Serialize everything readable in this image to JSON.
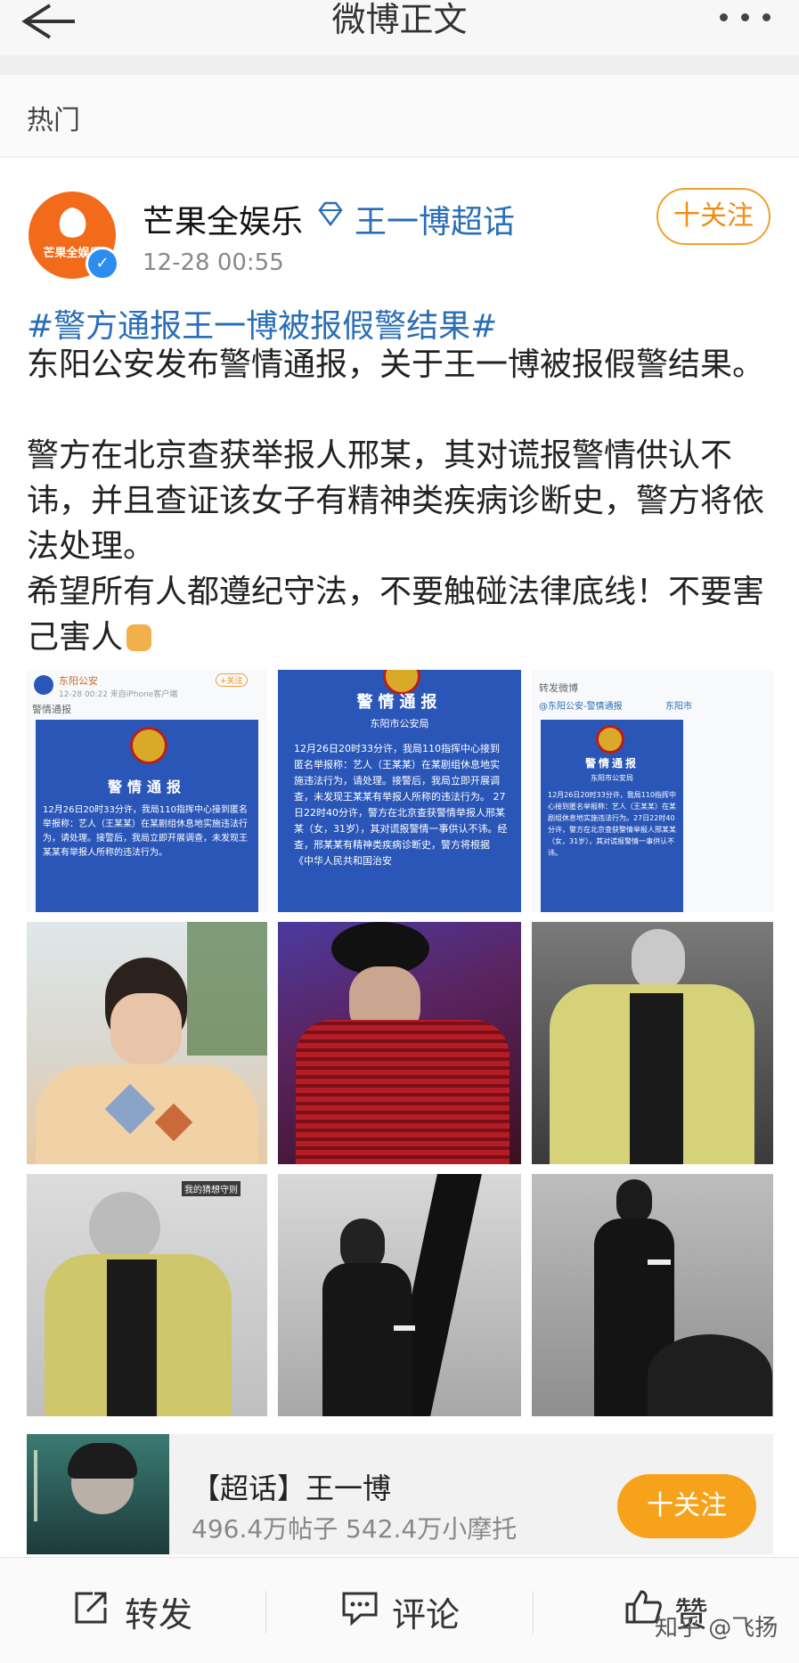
{
  "nav": {
    "title": "微博正文"
  },
  "section_label": "热门",
  "post": {
    "author": "芒果全娱乐",
    "avatar_text": "芒果全娱乐",
    "topic": "王一博超话",
    "time": "12-28 00:55",
    "follow_label": "十关注",
    "hashtag": "#警方通报王一博被报假警结果#",
    "paragraphs": [
      "东阳公安发布警情通报，关于王一博被报假警结果。",
      "警方在北京查获举报人邢某，其对谎报警情供认不讳，并且查证该女子有精神类疾病诊断史，警方将依法处理。",
      "希望所有人都遵纪守法，不要触碰法律底线！不要害己害人"
    ]
  },
  "images": {
    "notice1": {
      "account": "东阳公安",
      "meta": "12-28 00:22 来自iPhone客户端",
      "follow": "+关注",
      "section": "警情通报",
      "title": "警情通报",
      "body": "12月26日20时33分许，我局110指挥中心接到匿名举报称：艺人（王某某）在某剧组休息地实施违法行为，请处理。接警后，我局立即开展调查，未发现王某某有举报人所称的违法行为。"
    },
    "notice2": {
      "title": "警情通报",
      "sub": "东阳市公安局",
      "body": "12月26日20时33分许，我局110指挥中心接到匿名举报称：艺人（王某某）在某剧组休息地实施违法行为，请处理。接警后，我局立即开展调查，未发现王某某有举报人所称的违法行为。 27日22时40分许，警方在北京查获警情举报人邢某某（女，31岁），其对谎报警情一事供认不讳。经查，邢某某有精神类疾病诊断史，警方将根据《中华人民共和国治安"
    },
    "notice3": {
      "header": "转发微博",
      "account": "@东阳公安-警情通报",
      "location": "东阳市",
      "title": "警情通报",
      "sub": "东阳市公安局",
      "body": "12月26日20时33分许，我局110指挥中心接到匿名举报称：艺人（王某某）在某剧组休息地实施违法行为。27日22时40分许，警方在北京查获警情举报人邢某某（女，31岁），其对谎报警情一事供认不讳。"
    },
    "photo4_caption": "我的猜想守则"
  },
  "topic_card": {
    "title": "【超话】王一博",
    "stats": "496.4万帖子 542.4万小摩托",
    "follow_label": "十关注"
  },
  "bottom_bar": {
    "repost": "转发",
    "comment": "评论",
    "like": "赞"
  },
  "watermark": "知乎 @飞扬",
  "colors": {
    "link": "#2a6eb5",
    "accent": "#f7a21b",
    "avatar_bg": "#f26b1b",
    "notice_blue": "#2a56b8"
  }
}
